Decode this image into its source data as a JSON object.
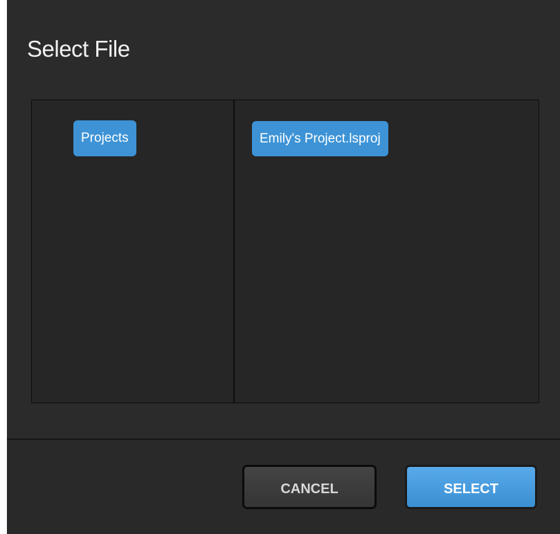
{
  "dialog": {
    "title": "Select File"
  },
  "browser": {
    "folders": [
      {
        "label": "Projects",
        "selected": true
      }
    ],
    "files": [
      {
        "label": "Emily's Project.lsproj",
        "selected": true
      }
    ]
  },
  "footer": {
    "cancel_label": "CANCEL",
    "select_label": "SELECT"
  },
  "colors": {
    "background": "#2b2b2b",
    "accent": "#3d93d6",
    "border": "#0d0d0d"
  }
}
